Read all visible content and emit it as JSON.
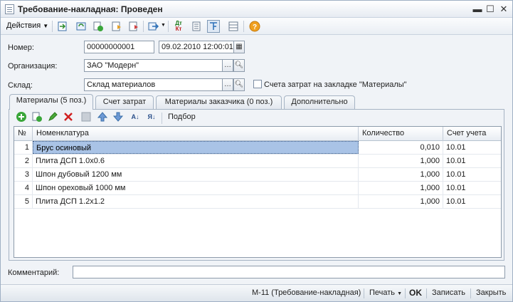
{
  "window": {
    "title": "Требование-накладная: Проведен"
  },
  "toolbar": {
    "actions_label": "Действия"
  },
  "form": {
    "number_label": "Номер:",
    "number_value": "00000000001",
    "date_value": "09.02.2010 12:00:01",
    "org_label": "Организация:",
    "org_value": "ЗАО \"Модерн\"",
    "warehouse_label": "Склад:",
    "warehouse_value": "Склад материалов",
    "checkbox_label": "Счета затрат на закладке \"Материалы\"",
    "comment_label": "Комментарий:",
    "comment_value": ""
  },
  "tabs": [
    {
      "label": "Материалы (5 поз.)",
      "active": true
    },
    {
      "label": "Счет затрат"
    },
    {
      "label": "Материалы заказчика (0 поз.)"
    },
    {
      "label": "Дополнительно"
    }
  ],
  "grid_toolbar": {
    "pick_label": "Подбор"
  },
  "table": {
    "columns": [
      "№",
      "Номенклатура",
      "Количество",
      "Счет учета"
    ],
    "rows": [
      {
        "n": "1",
        "name": "Брус осиновый",
        "qty": "0,010",
        "account": "10.01"
      },
      {
        "n": "2",
        "name": "Плита ДСП 1.0х0.6",
        "qty": "1,000",
        "account": "10.01"
      },
      {
        "n": "3",
        "name": "Шпон дубовый 1200 мм",
        "qty": "1,000",
        "account": "10.01"
      },
      {
        "n": "4",
        "name": "Шпон ореховый 1000 мм",
        "qty": "1,000",
        "account": "10.01"
      },
      {
        "n": "5",
        "name": "Плита ДСП 1.2х1.2",
        "qty": "1,000",
        "account": "10.01"
      }
    ]
  },
  "bottom": {
    "print_form": "М-11 (Требование-накладная)",
    "print": "Печать",
    "ok": "OK",
    "save": "Записать",
    "close": "Закрыть"
  }
}
